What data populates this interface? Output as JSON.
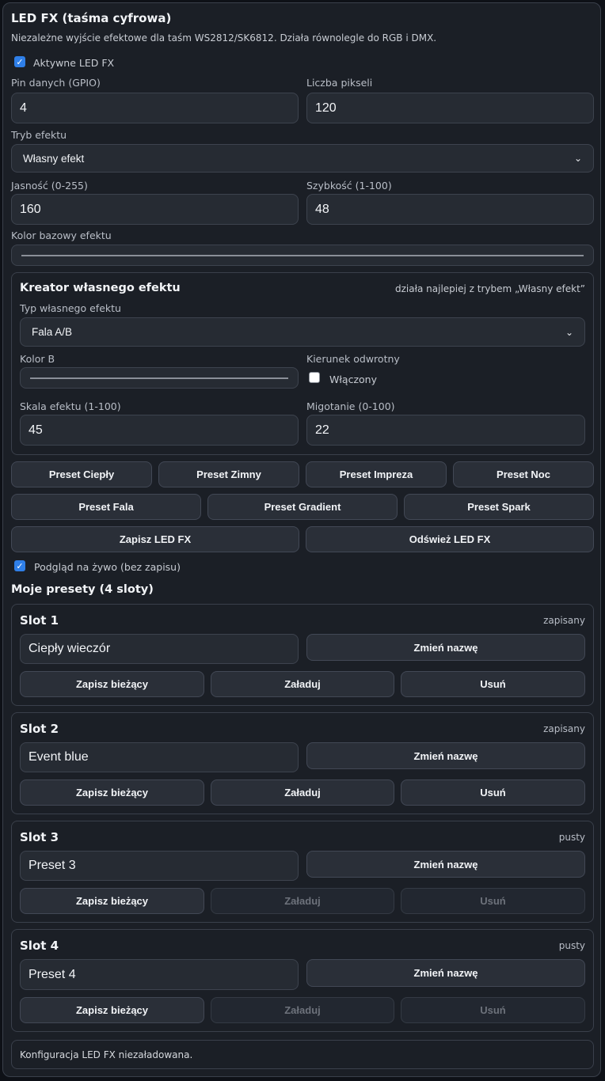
{
  "header": {
    "title": "LED FX (taśma cyfrowa)",
    "description": "Niezależne wyjście efektowe dla taśm WS2812/SK6812. Działa równolegle do RGB i DMX."
  },
  "enabled": {
    "label": "Aktywne LED FX",
    "checked": true
  },
  "fields": {
    "pin_label": "Pin danych (GPIO)",
    "pin_value": "4",
    "pixels_label": "Liczba pikseli",
    "pixels_value": "120",
    "mode_label": "Tryb efektu",
    "mode_value": "Własny efekt",
    "brightness_label": "Jasność (0-255)",
    "brightness_value": "160",
    "speed_label": "Szybkość (1-100)",
    "speed_value": "48",
    "base_color_label": "Kolor bazowy efektu"
  },
  "creator": {
    "title": "Kreator własnego efektu",
    "hint": "działa najlepiej z trybem „Własny efekt”",
    "type_label": "Typ własnego efektu",
    "type_value": "Fala A/B",
    "color_b_label": "Kolor B",
    "reverse_label": "Kierunek odwrotny",
    "reverse_check_label": "Włączony",
    "reverse_checked": false,
    "scale_label": "Skala efektu (1-100)",
    "scale_value": "45",
    "flicker_label": "Migotanie (0-100)",
    "flicker_value": "22"
  },
  "presets_row1": [
    "Preset Ciepły",
    "Preset Zimny",
    "Preset Impreza",
    "Preset Noc"
  ],
  "presets_row2": [
    "Preset Fala",
    "Preset Gradient",
    "Preset Spark"
  ],
  "actions": {
    "save": "Zapisz LED FX",
    "refresh": "Odśwież LED FX"
  },
  "live_preview": {
    "label": "Podgląd na żywo (bez zapisu)",
    "checked": true
  },
  "my_presets": {
    "title": "Moje presety (4 sloty)",
    "rename": "Zmień nazwę",
    "save_current": "Zapisz bieżący",
    "load": "Załaduj",
    "delete": "Usuń",
    "slots": [
      {
        "title": "Slot 1",
        "state": "zapisany",
        "name": "Ciepły wieczór"
      },
      {
        "title": "Slot 2",
        "state": "zapisany",
        "name": "Event blue"
      },
      {
        "title": "Slot 3",
        "state": "pusty",
        "name": "Preset 3"
      },
      {
        "title": "Slot 4",
        "state": "pusty",
        "name": "Preset 4"
      }
    ]
  },
  "status": "Konfiguracja LED FX niezaładowana.",
  "colors": {
    "accent": "#2f7fe8",
    "panel": "#1b1f26",
    "input": "#262b33"
  }
}
